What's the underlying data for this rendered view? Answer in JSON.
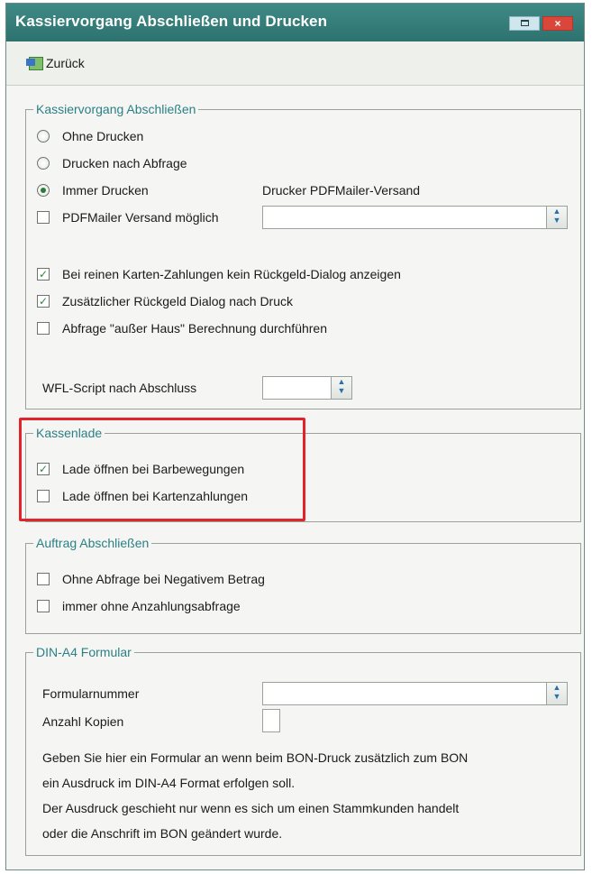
{
  "window": {
    "title": "Kassiervorgang Abschließen und Drucken",
    "close_glyph": "×"
  },
  "toolbar": {
    "back_label": "Zurück"
  },
  "section_abschliessen": {
    "title": "Kassiervorgang Abschließen",
    "radio_ohne": "Ohne Drucken",
    "radio_abfrage": "Drucken nach Abfrage",
    "radio_immer": "Immer Drucken",
    "printer_label": "Drucker PDFMailer-Versand",
    "pdfmailer_label": "PDFMailer Versand möglich",
    "pdfmailer_value": "",
    "cb_karten_label": "Bei reinen Karten-Zahlungen kein Rückgeld-Dialog anzeigen",
    "cb_rueckgeld_label": "Zusätzlicher Rückgeld Dialog nach Druck",
    "cb_ausserhaus_label": "Abfrage \"außer Haus\" Berechnung durchführen",
    "wfl_label": "WFL-Script nach Abschluss",
    "wfl_value": ""
  },
  "section_kassenlade": {
    "title": "Kassenlade",
    "cb_barbewegungen_label": "Lade öffnen bei Barbewegungen",
    "cb_kartenzahlungen_label": "Lade öffnen bei Kartenzahlungen"
  },
  "section_auftrag": {
    "title": "Auftrag Abschließen",
    "cb_negativ_label": "Ohne Abfrage bei Negativem Betrag",
    "cb_anzahlung_label": "immer ohne Anzahlungsabfrage"
  },
  "section_din": {
    "title": "DIN-A4 Formular",
    "formular_label": "Formularnummer",
    "formular_value": "",
    "kopien_label": "Anzahl Kopien",
    "kopien_value": "",
    "info_line1": "Geben Sie hier ein Formular an wenn beim BON-Druck zusätzlich zum BON",
    "info_line2": "ein Ausdruck im DIN-A4 Format erfolgen soll.",
    "info_line3": "Der Ausdruck geschieht nur wenn es sich um einen Stammkunden handelt",
    "info_line4": "oder die Anschrift im BON geändert wurde."
  },
  "icons": {
    "back": "back-arrow-icon",
    "check": "✓",
    "spin_up": "▲",
    "spin_down": "▼"
  },
  "states": {
    "radio_selected": "Immer Drucken",
    "checked": [
      "Bei reinen Karten-Zahlungen kein Rückgeld-Dialog anzeigen",
      "Zusätzlicher Rückgeld Dialog nach Druck",
      "Lade öffnen bei Barbewegungen"
    ]
  },
  "colors": {
    "titlebar": "#2d726e",
    "group_title": "#2b7f86",
    "highlight": "#e0242a",
    "check": "#2d8a3b"
  }
}
